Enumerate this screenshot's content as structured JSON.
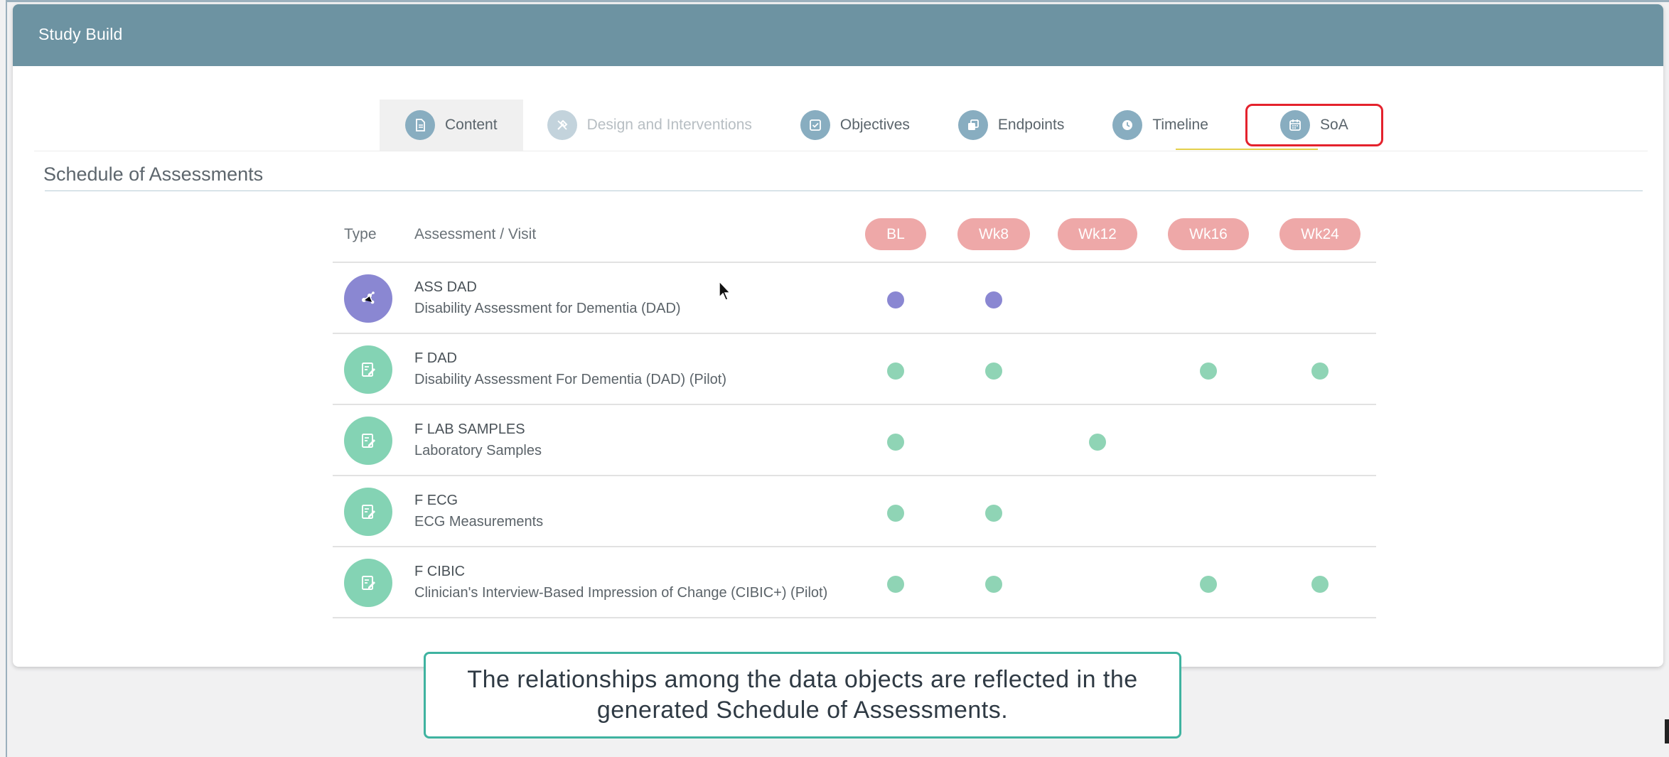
{
  "app": {
    "title": "Study Build"
  },
  "tabs": [
    {
      "label": "Content",
      "icon": "document-icon",
      "disabled": false
    },
    {
      "label": "Design and Interventions",
      "icon": "tools-icon",
      "disabled": true
    },
    {
      "label": "Objectives",
      "icon": "checkbox-icon",
      "disabled": false
    },
    {
      "label": "Endpoints",
      "icon": "layers-icon",
      "disabled": false
    },
    {
      "label": "Timeline",
      "icon": "clock-icon",
      "disabled": false
    },
    {
      "label": "SoA",
      "icon": "calendar-icon",
      "disabled": false,
      "highlighted": true
    }
  ],
  "section": {
    "title": "Schedule of Assessments"
  },
  "soa": {
    "headers": {
      "type": "Type",
      "assessment": "Assessment / Visit"
    },
    "visits": [
      "BL",
      "Wk8",
      "Wk12",
      "Wk16",
      "Wk24"
    ],
    "rows": [
      {
        "kind": "assessment",
        "icon": "network-icon",
        "code": "ASS DAD",
        "name": "Disability Assessment for Dementia (DAD)",
        "marks": [
          true,
          true,
          false,
          false,
          false
        ]
      },
      {
        "kind": "form",
        "icon": "form-icon",
        "code": "F DAD",
        "name": "Disability Assessment For Dementia (DAD) (Pilot)",
        "marks": [
          true,
          true,
          false,
          true,
          true
        ]
      },
      {
        "kind": "form",
        "icon": "form-icon",
        "code": "F LAB SAMPLES",
        "name": "Laboratory Samples",
        "marks": [
          true,
          false,
          true,
          false,
          false
        ]
      },
      {
        "kind": "form",
        "icon": "form-icon",
        "code": "F ECG",
        "name": "ECG Measurements",
        "marks": [
          true,
          true,
          false,
          false,
          false
        ]
      },
      {
        "kind": "form",
        "icon": "form-icon",
        "code": "F CIBIC",
        "name": "Clinician's Interview-Based Impression of Change (CIBIC+) (Pilot)",
        "marks": [
          true,
          true,
          false,
          true,
          true
        ]
      }
    ]
  },
  "caption": {
    "text": "The relationships among the data objects are reflected in the generated Schedule of Assessments."
  },
  "colors": {
    "header_bar": "#6d93a2",
    "visit_pill": "#eea8a8",
    "assessment": "#8a87d2",
    "form": "#84d3b4",
    "highlight_border": "#e4222d",
    "caption_border": "#3fb3a0"
  }
}
